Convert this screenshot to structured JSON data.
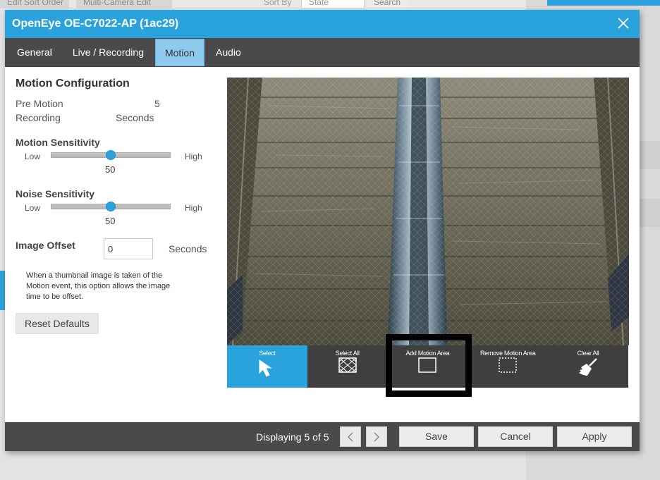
{
  "background": {
    "edit_sort_order": "Edit Sort Order",
    "multi_camera_edit": "Multi-Camera Edit",
    "sort_by_label": "Sort By",
    "sort_by_value": "State",
    "search_label": "Search"
  },
  "dialog": {
    "title": "OpenEye OE-C7022-AP (1ac29)",
    "tabs": [
      {
        "label": "General"
      },
      {
        "label": "Live / Recording"
      },
      {
        "label": "Motion"
      },
      {
        "label": "Audio"
      }
    ],
    "active_tab": "Motion"
  },
  "config": {
    "heading": "Motion Configuration",
    "pre_motion_label_1": "Pre Motion",
    "pre_motion_label_2": "Recording",
    "pre_motion_value": "5",
    "pre_motion_unit": "Seconds",
    "motion_sensitivity": {
      "label": "Motion Sensitivity",
      "low": "Low",
      "high": "High",
      "value": "50",
      "fraction": 0.5
    },
    "noise_sensitivity": {
      "label": "Noise Sensitivity",
      "low": "Low",
      "high": "High",
      "value": "50",
      "fraction": 0.5
    },
    "image_offset": {
      "label": "Image Offset",
      "value": "0",
      "unit": "Seconds"
    },
    "help_line_1": "When a thumbnail image is taken of the",
    "help_line_2": "Motion event, this option allows the image",
    "help_line_3": "time to be offset.",
    "reset_label": "Reset Defaults"
  },
  "toolbar": {
    "tools": [
      {
        "label": "Select",
        "icon": "cursor-arrow-icon"
      },
      {
        "label": "Select All",
        "icon": "grid-select-all-icon"
      },
      {
        "label": "Add Motion Area",
        "icon": "add-area-square-icon"
      },
      {
        "label": "Remove Motion Area",
        "icon": "remove-area-dashed-icon"
      },
      {
        "label": "Clear All",
        "icon": "broom-icon"
      }
    ],
    "active_tool": "Select"
  },
  "footer": {
    "displaying": "Displaying 5 of 5",
    "save": "Save",
    "cancel": "Cancel",
    "apply": "Apply"
  },
  "colors": {
    "accent": "#2aa3dc",
    "dark_bar": "#4a4a4a",
    "active_tab": "#8ecbef"
  }
}
